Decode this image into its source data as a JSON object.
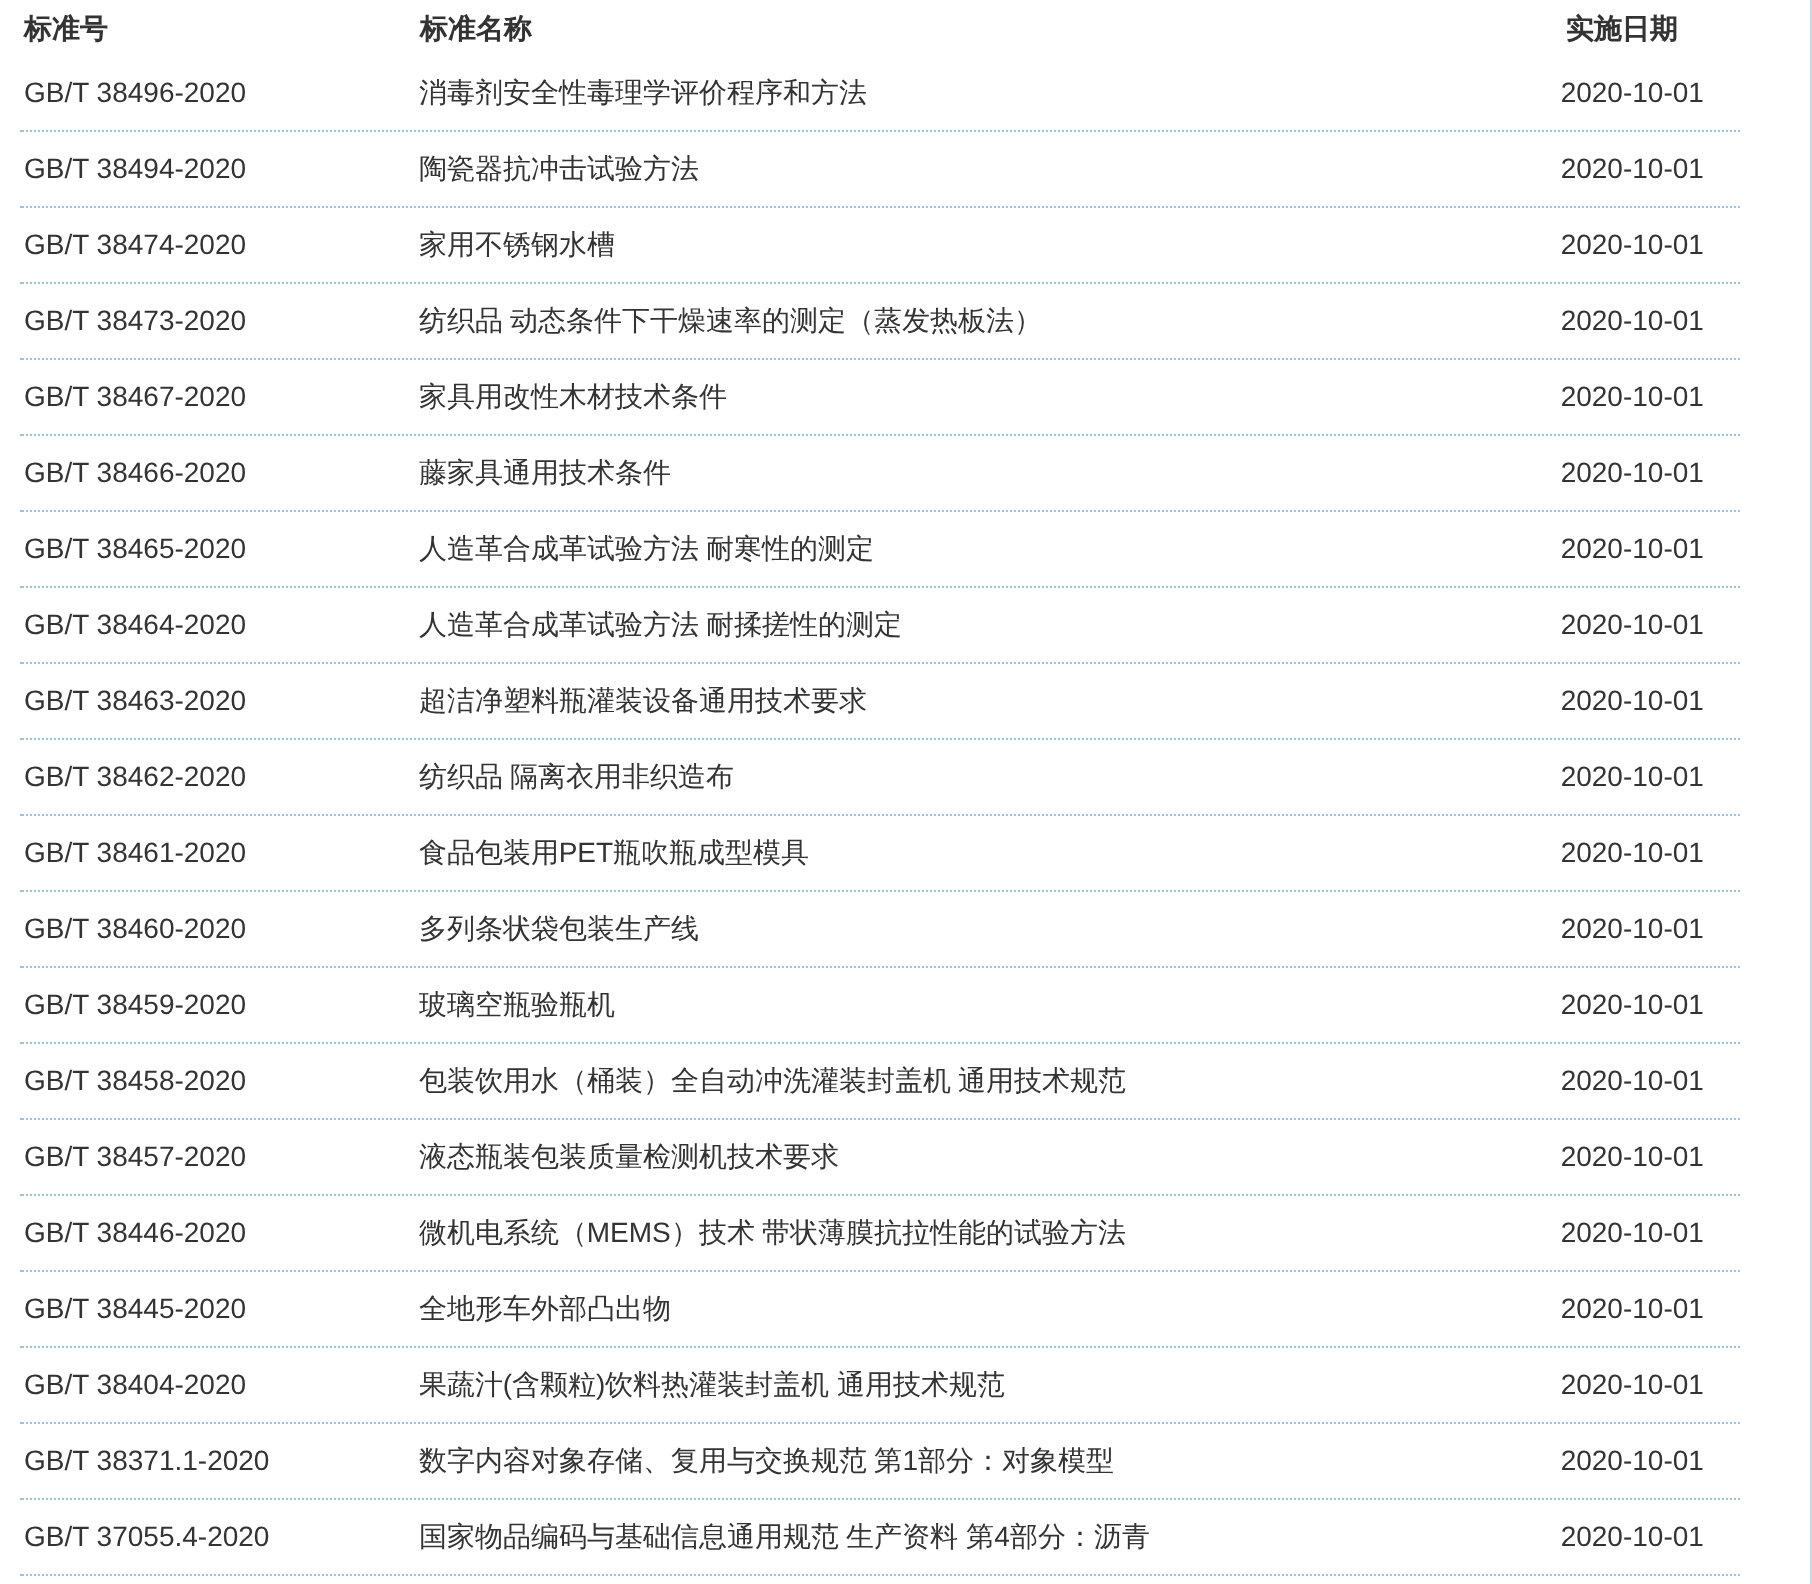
{
  "table": {
    "columns": [
      "标准号",
      "标准名称",
      "实施日期"
    ],
    "rows": [
      [
        "GB/T 38496-2020",
        "消毒剂安全性毒理学评价程序和方法",
        "2020-10-01"
      ],
      [
        "GB/T 38494-2020",
        "陶瓷器抗冲击试验方法",
        "2020-10-01"
      ],
      [
        "GB/T 38474-2020",
        "家用不锈钢水槽",
        "2020-10-01"
      ],
      [
        "GB/T 38473-2020",
        "纺织品 动态条件下干燥速率的测定（蒸发热板法）",
        "2020-10-01"
      ],
      [
        "GB/T 38467-2020",
        "家具用改性木材技术条件",
        "2020-10-01"
      ],
      [
        "GB/T 38466-2020",
        "藤家具通用技术条件",
        "2020-10-01"
      ],
      [
        "GB/T 38465-2020",
        "人造革合成革试验方法 耐寒性的测定",
        "2020-10-01"
      ],
      [
        "GB/T 38464-2020",
        "人造革合成革试验方法 耐揉搓性的测定",
        "2020-10-01"
      ],
      [
        "GB/T 38463-2020",
        "超洁净塑料瓶灌装设备通用技术要求",
        "2020-10-01"
      ],
      [
        "GB/T 38462-2020",
        "纺织品 隔离衣用非织造布",
        "2020-10-01"
      ],
      [
        "GB/T 38461-2020",
        "食品包装用PET瓶吹瓶成型模具",
        "2020-10-01"
      ],
      [
        "GB/T 38460-2020",
        "多列条状袋包装生产线",
        "2020-10-01"
      ],
      [
        "GB/T 38459-2020",
        "玻璃空瓶验瓶机",
        "2020-10-01"
      ],
      [
        "GB/T 38458-2020",
        "包装饮用水（桶装）全自动冲洗灌装封盖机 通用技术规范",
        "2020-10-01"
      ],
      [
        "GB/T 38457-2020",
        "液态瓶装包装质量检测机技术要求",
        "2020-10-01"
      ],
      [
        "GB/T 38446-2020",
        "微机电系统（MEMS）技术 带状薄膜抗拉性能的试验方法",
        "2020-10-01"
      ],
      [
        "GB/T 38445-2020",
        "全地形车外部凸出物",
        "2020-10-01"
      ],
      [
        "GB/T 38404-2020",
        "果蔬汁(含颗粒)饮料热灌装封盖机 通用技术规范",
        "2020-10-01"
      ],
      [
        "GB/T 38371.1-2020",
        "数字内容对象存储、复用与交换规范 第1部分：对象模型",
        "2020-10-01"
      ],
      [
        "GB/T 37055.4-2020",
        "国家物品编码与基础信息通用规范 生产资料 第4部分：沥青",
        "2020-10-01"
      ]
    ]
  }
}
